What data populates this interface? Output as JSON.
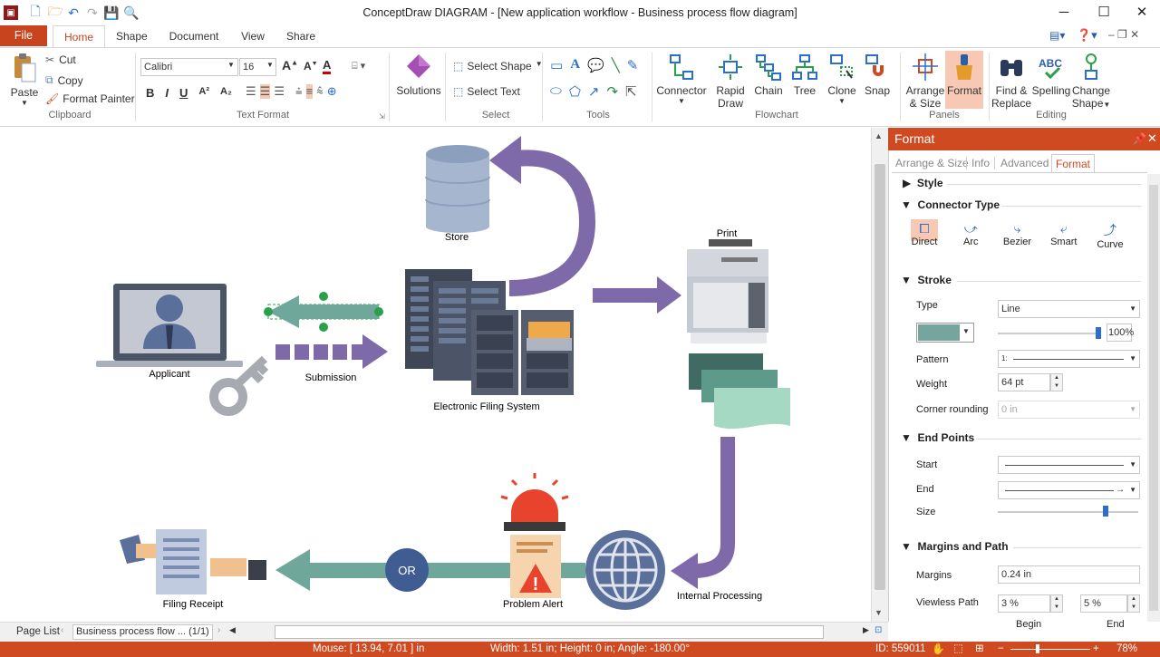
{
  "window": {
    "title": "ConceptDraw DIAGRAM - [New application workflow - Business process flow diagram]"
  },
  "tabs": {
    "file": "File",
    "home": "Home",
    "shape": "Shape",
    "document": "Document",
    "view": "View",
    "share": "Share"
  },
  "ribbon": {
    "clipboard": {
      "paste": "Paste",
      "cut": "Cut",
      "copy": "Copy",
      "format_painter": "Format Painter",
      "group": "Clipboard"
    },
    "text_format": {
      "font": "Calibri",
      "size": "16",
      "group": "Text Format"
    },
    "solutions": {
      "label": "Solutions"
    },
    "select": {
      "select_shape": "Select Shape",
      "select_text": "Select Text",
      "group": "Select"
    },
    "tools": {
      "group": "Tools"
    },
    "flowchart": {
      "connector": "Connector",
      "rapid_draw_1": "Rapid",
      "rapid_draw_2": "Draw",
      "chain": "Chain",
      "tree": "Tree",
      "clone": "Clone",
      "snap": "Snap",
      "group": "Flowchart"
    },
    "panels": {
      "arrange_1": "Arrange",
      "arrange_2": "& Size",
      "format": "Format",
      "group": "Panels"
    },
    "editing": {
      "find_1": "Find &",
      "find_2": "Replace",
      "spelling": "Spelling",
      "change_1": "Change",
      "change_2": "Shape",
      "group": "Editing"
    }
  },
  "diagram": {
    "store": "Store",
    "print": "Print",
    "applicant": "Applicant",
    "submission": "Submission",
    "efs": "Electronic Filing System",
    "internal": "Internal Processing",
    "alert": "Problem Alert",
    "or": "OR",
    "receipt": "Filing Receipt"
  },
  "panel": {
    "title": "Format",
    "tabs": [
      "Arrange & Size",
      "Info",
      "Advanced",
      "Format"
    ],
    "style": "Style",
    "connector_type": "Connector Type",
    "connectors": [
      "Direct",
      "Arc",
      "Bezier",
      "Smart",
      "Curve"
    ],
    "stroke": "Stroke",
    "type_label": "Type",
    "type_value": "Line",
    "opacity": "100%",
    "pattern_label": "Pattern",
    "pattern_value": "1:",
    "weight_label": "Weight",
    "weight_value": "64 pt",
    "corner_label": "Corner rounding",
    "corner_value": "0 in",
    "endpoints": "End Points",
    "start": "Start",
    "end": "End",
    "size": "Size",
    "margins_path": "Margins and Path",
    "margins_label": "Margins",
    "margins_value": "0.24 in",
    "viewless_label": "Viewless Path",
    "begin_value": "3 %",
    "end_value": "5 %",
    "begin": "Begin",
    "end_col": "End",
    "stroke_color": "#76a59d"
  },
  "bottom": {
    "page_list": "Page List",
    "page_select": "Business process flow ... (1/1)"
  },
  "status": {
    "mouse": "Mouse: [ 13.94, 7.01 ] in",
    "dims": "Width: 1.51 in;  Height: 0 in;  Angle: -180.00°",
    "id": "ID: 559011",
    "zoom": "78%"
  },
  "colors": {
    "accent": "#d04a21",
    "purple": "#7e6aa8",
    "teal": "#6fa79a",
    "navy": "#5a6f9a"
  }
}
